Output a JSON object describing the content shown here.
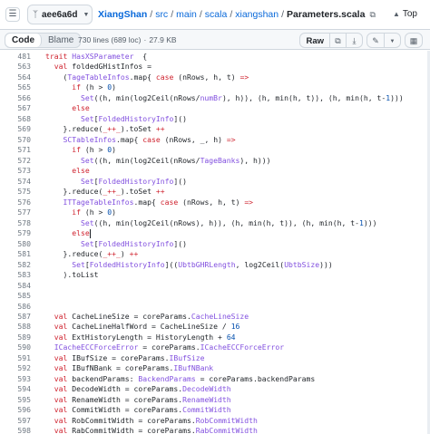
{
  "header": {
    "branch": "aee6a6d",
    "breadcrumb": [
      {
        "text": "XiangShan",
        "kind": "repo"
      },
      {
        "text": "src",
        "kind": "dir"
      },
      {
        "text": "main",
        "kind": "dir"
      },
      {
        "text": "scala",
        "kind": "dir"
      },
      {
        "text": "xiangshan",
        "kind": "dir"
      }
    ],
    "current_file": "Parameters.scala",
    "top_link": "Top"
  },
  "toolbar": {
    "code_tab": "Code",
    "blame_tab": "Blame",
    "lines_info": "730 lines (689 loc)",
    "size_info": "27.9 KB",
    "raw_label": "Raw"
  },
  "icons": {
    "tree_toggle": "side-panel-icon",
    "branch": "git-branch-icon",
    "copy_path": "copy-icon",
    "top": "arrow-up-icon",
    "copy_raw": "copy-icon",
    "download": "download-icon",
    "edit": "pencil-icon",
    "edit_menu": "chevron-down-icon",
    "symbols": "code-square-icon"
  },
  "colors": {
    "keyword": "#cf222e",
    "type": "#8250df",
    "constant": "#0550ae",
    "link": "#0969da",
    "line_number": "#6e7781"
  },
  "code_lines": [
    {
      "n": "481",
      "tokens": [
        [
          "k",
          "trait "
        ],
        [
          "t",
          "HasXSParameter"
        ],
        [
          "",
          "  {"
        ]
      ]
    },
    {
      "n": "563",
      "tokens": [
        [
          "",
          "  "
        ],
        [
          "k",
          "val "
        ],
        [
          "",
          "foldedGHistInfos ="
        ]
      ]
    },
    {
      "n": "564",
      "tokens": [
        [
          "",
          "    ("
        ],
        [
          "t",
          "TageTableInfos"
        ],
        [
          "",
          ".map{ "
        ],
        [
          "k",
          "case"
        ],
        [
          "",
          " (nRows, h, t) "
        ],
        [
          "k",
          "=>"
        ]
      ]
    },
    {
      "n": "565",
      "tokens": [
        [
          "",
          "      "
        ],
        [
          "k",
          "if"
        ],
        [
          "",
          " (h > "
        ],
        [
          "c",
          "0"
        ],
        [
          "",
          ")"
        ]
      ]
    },
    {
      "n": "566",
      "tokens": [
        [
          "",
          "        "
        ],
        [
          "t",
          "Set"
        ],
        [
          "",
          "((h, min(log2Ceil(nRows/"
        ],
        [
          "t",
          "numBr"
        ],
        [
          "",
          "), h)), (h, min(h, t)), (h, min(h, t-"
        ],
        [
          "c",
          "1"
        ],
        [
          "",
          ")))"
        ]
      ]
    },
    {
      "n": "567",
      "tokens": [
        [
          "",
          "      "
        ],
        [
          "k",
          "else"
        ]
      ]
    },
    {
      "n": "568",
      "tokens": [
        [
          "",
          "        "
        ],
        [
          "t",
          "Set"
        ],
        [
          "",
          "["
        ],
        [
          "t",
          "FoldedHistoryInfo"
        ],
        [
          "",
          "]()"
        ]
      ]
    },
    {
      "n": "569",
      "tokens": [
        [
          "",
          "    }.reduce("
        ],
        [
          "k",
          "_++_"
        ],
        [
          "",
          ").toSet "
        ],
        [
          "k",
          "++"
        ]
      ]
    },
    {
      "n": "570",
      "tokens": [
        [
          "",
          "    "
        ],
        [
          "t",
          "SCTableInfos"
        ],
        [
          "",
          ".map{ "
        ],
        [
          "k",
          "case"
        ],
        [
          "",
          " (nRows, _, h) "
        ],
        [
          "k",
          "=>"
        ]
      ]
    },
    {
      "n": "571",
      "tokens": [
        [
          "",
          "      "
        ],
        [
          "k",
          "if"
        ],
        [
          "",
          " (h > "
        ],
        [
          "c",
          "0"
        ],
        [
          "",
          ")"
        ]
      ]
    },
    {
      "n": "572",
      "tokens": [
        [
          "",
          "        "
        ],
        [
          "t",
          "Set"
        ],
        [
          "",
          "((h, min(log2Ceil(nRows/"
        ],
        [
          "t",
          "TageBanks"
        ],
        [
          "",
          "), h)))"
        ]
      ]
    },
    {
      "n": "573",
      "tokens": [
        [
          "",
          "      "
        ],
        [
          "k",
          "else"
        ]
      ]
    },
    {
      "n": "574",
      "tokens": [
        [
          "",
          "        "
        ],
        [
          "t",
          "Set"
        ],
        [
          "",
          "["
        ],
        [
          "t",
          "FoldedHistoryInfo"
        ],
        [
          "",
          "]()"
        ]
      ]
    },
    {
      "n": "575",
      "tokens": [
        [
          "",
          "    }.reduce("
        ],
        [
          "k",
          "_++_"
        ],
        [
          "",
          ").toSet "
        ],
        [
          "k",
          "++"
        ]
      ]
    },
    {
      "n": "576",
      "tokens": [
        [
          "",
          "    "
        ],
        [
          "t",
          "ITTageTableInfos"
        ],
        [
          "",
          ".map{ "
        ],
        [
          "k",
          "case"
        ],
        [
          "",
          " (nRows, h, t) "
        ],
        [
          "k",
          "=>"
        ]
      ]
    },
    {
      "n": "577",
      "tokens": [
        [
          "",
          "      "
        ],
        [
          "k",
          "if"
        ],
        [
          "",
          " (h > "
        ],
        [
          "c",
          "0"
        ],
        [
          "",
          ")"
        ]
      ]
    },
    {
      "n": "578",
      "tokens": [
        [
          "",
          "        "
        ],
        [
          "t",
          "Set"
        ],
        [
          "",
          "((h, min(log2Ceil(nRows), h)), (h, min(h, t)), (h, min(h, t-"
        ],
        [
          "c",
          "1"
        ],
        [
          "",
          ")))"
        ]
      ]
    },
    {
      "n": "579",
      "tokens": [
        [
          "",
          "      "
        ],
        [
          "k",
          "else"
        ],
        [
          "|",
          ""
        ]
      ]
    },
    {
      "n": "580",
      "tokens": [
        [
          "",
          "        "
        ],
        [
          "t",
          "Set"
        ],
        [
          "",
          "["
        ],
        [
          "t",
          "FoldedHistoryInfo"
        ],
        [
          "",
          "]()"
        ]
      ]
    },
    {
      "n": "581",
      "tokens": [
        [
          "",
          "    }.reduce("
        ],
        [
          "k",
          "_++_"
        ],
        [
          "",
          ") "
        ],
        [
          "k",
          "++"
        ]
      ]
    },
    {
      "n": "582",
      "tokens": [
        [
          "",
          "      "
        ],
        [
          "t",
          "Set"
        ],
        [
          "",
          "["
        ],
        [
          "t",
          "FoldedHistoryInfo"
        ],
        [
          "",
          "](("
        ],
        [
          "t",
          "UbtbGHRLength"
        ],
        [
          "",
          ", log2Ceil("
        ],
        [
          "t",
          "UbtbSize"
        ],
        [
          "",
          ")))"
        ]
      ]
    },
    {
      "n": "583",
      "tokens": [
        [
          "",
          "    ).toList"
        ]
      ]
    },
    {
      "n": "584",
      "tokens": []
    },
    {
      "n": "585",
      "tokens": []
    },
    {
      "n": "586",
      "tokens": []
    },
    {
      "n": "587",
      "tokens": [
        [
          "",
          "  "
        ],
        [
          "k",
          "val "
        ],
        [
          "",
          "CacheLineSize = coreParams."
        ],
        [
          "t",
          "CacheLineSize"
        ]
      ]
    },
    {
      "n": "588",
      "tokens": [
        [
          "",
          "  "
        ],
        [
          "k",
          "val "
        ],
        [
          "",
          "CacheLineHalfWord = CacheLineSize / "
        ],
        [
          "c",
          "16"
        ]
      ]
    },
    {
      "n": "589",
      "tokens": [
        [
          "",
          "  "
        ],
        [
          "k",
          "val "
        ],
        [
          "",
          "ExtHistoryLength = HistoryLength + "
        ],
        [
          "c",
          "64"
        ]
      ]
    },
    {
      "n": "590",
      "tokens": [
        [
          "",
          "  "
        ],
        [
          "t",
          "ICacheECCForceError"
        ],
        [
          "",
          " = coreParams."
        ],
        [
          "t",
          "ICacheECCForceError"
        ]
      ]
    },
    {
      "n": "591",
      "tokens": [
        [
          "",
          "  "
        ],
        [
          "k",
          "val "
        ],
        [
          "",
          "IBufSize = coreParams."
        ],
        [
          "t",
          "IBufSize"
        ]
      ]
    },
    {
      "n": "592",
      "tokens": [
        [
          "",
          "  "
        ],
        [
          "k",
          "val "
        ],
        [
          "",
          "IBufNBank = coreParams."
        ],
        [
          "t",
          "IBufNBank"
        ]
      ]
    },
    {
      "n": "593",
      "tokens": [
        [
          "",
          "  "
        ],
        [
          "k",
          "val "
        ],
        [
          "",
          "backendParams: "
        ],
        [
          "t",
          "BackendParams"
        ],
        [
          "",
          " = coreParams.backendParams"
        ]
      ]
    },
    {
      "n": "594",
      "tokens": [
        [
          "",
          "  "
        ],
        [
          "k",
          "val "
        ],
        [
          "",
          "DecodeWidth = coreParams."
        ],
        [
          "t",
          "DecodeWidth"
        ]
      ]
    },
    {
      "n": "595",
      "tokens": [
        [
          "",
          "  "
        ],
        [
          "k",
          "val "
        ],
        [
          "",
          "RenameWidth = coreParams."
        ],
        [
          "t",
          "RenameWidth"
        ]
      ]
    },
    {
      "n": "596",
      "tokens": [
        [
          "",
          "  "
        ],
        [
          "k",
          "val "
        ],
        [
          "",
          "CommitWidth = coreParams."
        ],
        [
          "t",
          "CommitWidth"
        ]
      ]
    },
    {
      "n": "597",
      "tokens": [
        [
          "",
          "  "
        ],
        [
          "k",
          "val "
        ],
        [
          "",
          "RobCommitWidth = coreParams."
        ],
        [
          "t",
          "RobCommitWidth"
        ]
      ]
    },
    {
      "n": "598",
      "tokens": [
        [
          "",
          "  "
        ],
        [
          "k",
          "val "
        ],
        [
          "",
          "RabCommitWidth = coreParams."
        ],
        [
          "t",
          "RabCommitWidth"
        ]
      ]
    }
  ]
}
